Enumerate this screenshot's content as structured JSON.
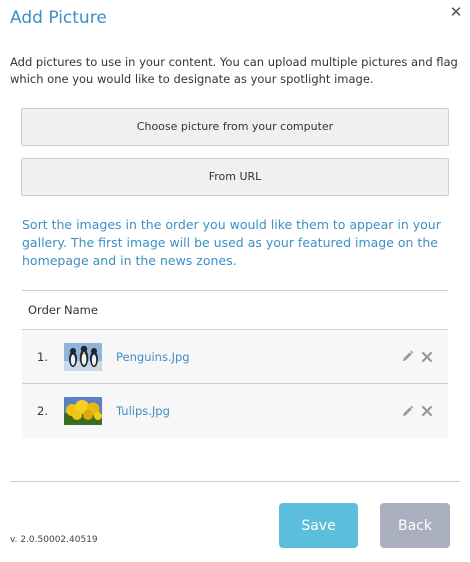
{
  "dialog": {
    "title": "Add Picture",
    "close_icon": "close-icon"
  },
  "intro": "Add pictures to use in your content. You can upload multiple pictures and flag which one you would like to designate as your spotlight image.",
  "buttons": {
    "choose": "Choose picture from your computer",
    "from_url": "From URL",
    "save": "Save",
    "back": "Back"
  },
  "sort_note": "Sort the images in the order you would like them to appear in your gallery. The first image will be used as your featured image on the homepage and in the news zones.",
  "table": {
    "headers": {
      "order": "Order",
      "name": "Name"
    },
    "rows": [
      {
        "order": "1.",
        "name": "Penguins.Jpg",
        "thumb_icon": "penguins-thumbnail",
        "actions": [
          "edit-icon",
          "delete-icon"
        ]
      },
      {
        "order": "2.",
        "name": "Tulips.Jpg",
        "thumb_icon": "tulips-thumbnail",
        "actions": [
          "edit-icon",
          "delete-icon"
        ]
      }
    ]
  },
  "footer": {
    "version": "v. 2.0.50002.40519"
  },
  "colors": {
    "accent": "#3d8fc4",
    "save_bg": "#5bbfdb",
    "back_bg": "#a9afbf"
  }
}
